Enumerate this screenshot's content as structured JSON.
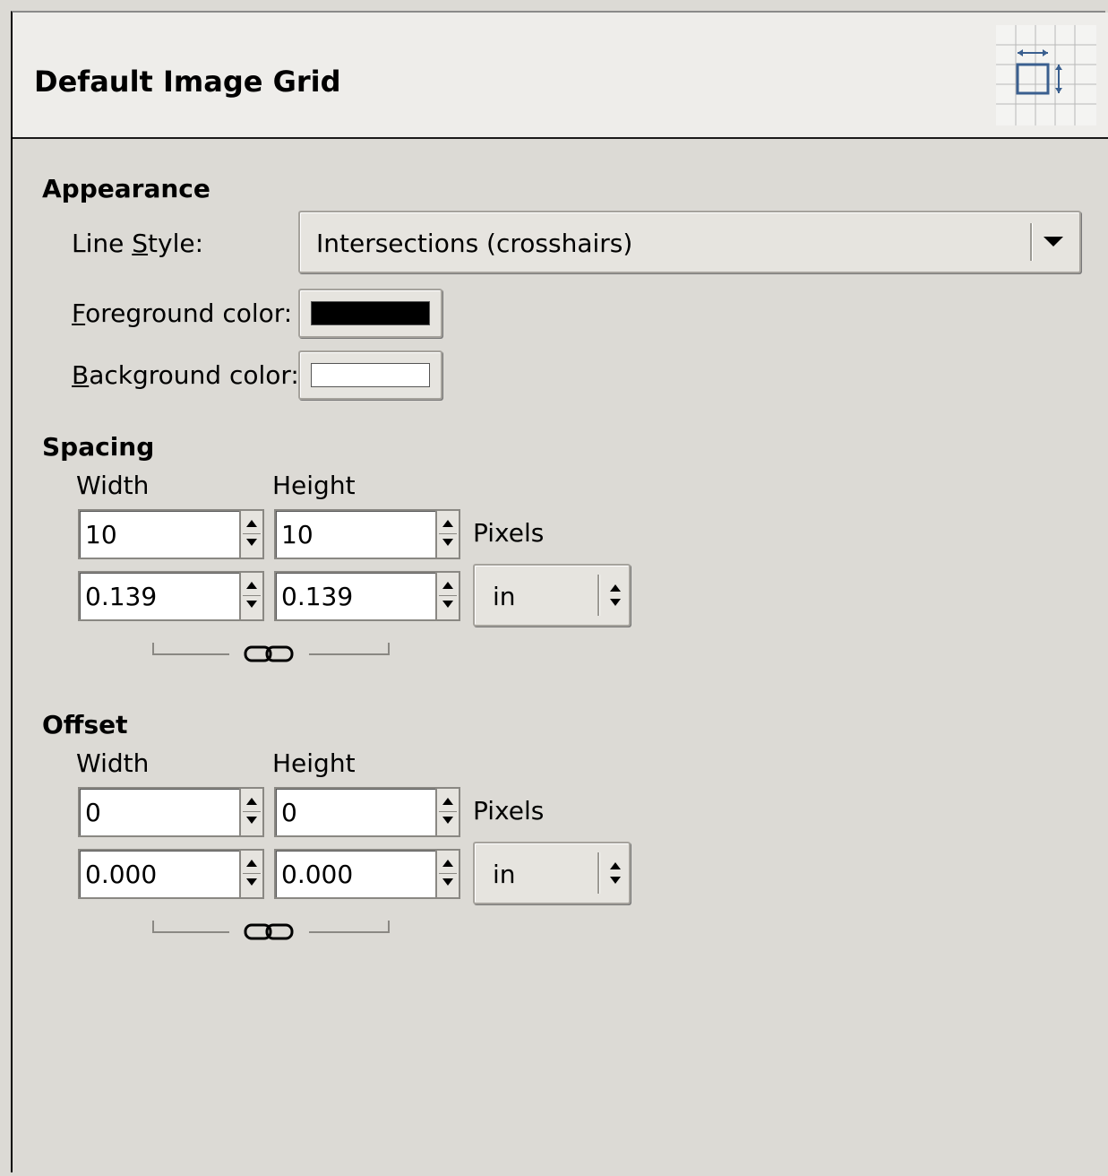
{
  "header": {
    "title": "Default Image Grid",
    "icon": "grid-spacing-icon"
  },
  "appearance": {
    "section_title": "Appearance",
    "line_style_label_pre": "Line ",
    "line_style_label_mnemonic": "S",
    "line_style_label_post": "tyle:",
    "line_style_value": "Intersections (crosshairs)",
    "foreground_label_mnemonic": "F",
    "foreground_label_rest": "oreground color:",
    "foreground_color": "#000000",
    "background_label_mnemonic": "B",
    "background_label_rest": "ackground color:",
    "background_color": "#ffffff"
  },
  "spacing": {
    "section_title": "Spacing",
    "width_label": "Width",
    "height_label": "Height",
    "width_pixels": "10",
    "height_pixels": "10",
    "pixels_label": "Pixels",
    "width_units": "0.139",
    "height_units": "0.139",
    "unit": "in",
    "chain_icon": "chain-link-icon"
  },
  "offset": {
    "section_title": "Offset",
    "width_label": "Width",
    "height_label": "Height",
    "width_pixels": "0",
    "height_pixels": "0",
    "pixels_label": "Pixels",
    "width_units": "0.000",
    "height_units": "0.000",
    "unit": "in",
    "chain_icon": "chain-link-icon"
  }
}
